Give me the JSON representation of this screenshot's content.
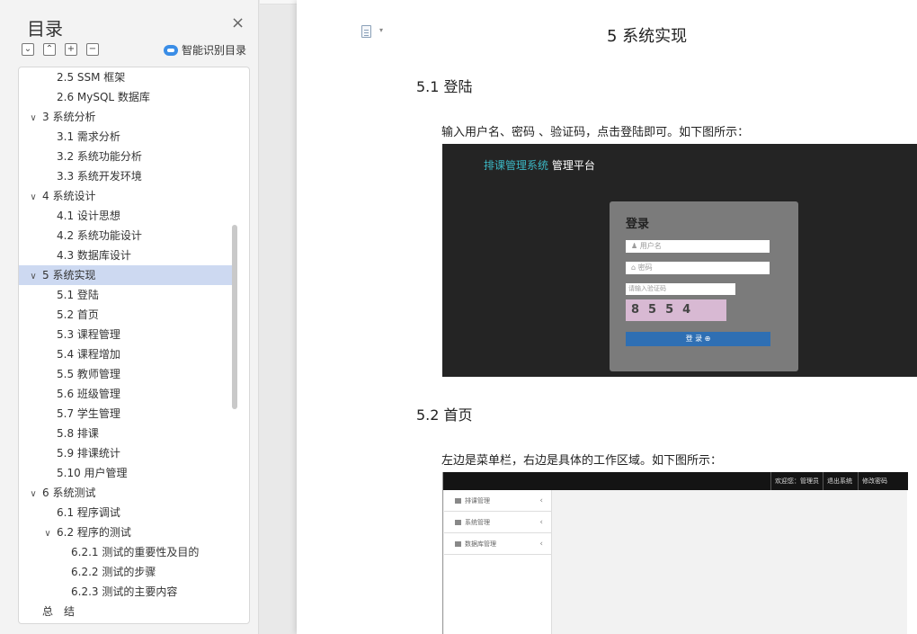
{
  "sidebar": {
    "title": "目录",
    "close_glyph": "×",
    "tools": [
      "⌄",
      "⌃",
      "+",
      "−"
    ],
    "smart_label": "智能识别目录",
    "items": [
      {
        "label": "2.5 SSM 框架",
        "level": 2,
        "chev": ""
      },
      {
        "label": "2.6 MySQL 数据库",
        "level": 2,
        "chev": ""
      },
      {
        "label": "3 系统分析",
        "level": 1,
        "chev": "∨"
      },
      {
        "label": "3.1 需求分析",
        "level": 2,
        "chev": ""
      },
      {
        "label": "3.2 系统功能分析",
        "level": 2,
        "chev": ""
      },
      {
        "label": "3.3 系统开发环境",
        "level": 2,
        "chev": ""
      },
      {
        "label": "4 系统设计",
        "level": 1,
        "chev": "∨"
      },
      {
        "label": "4.1 设计思想",
        "level": 2,
        "chev": ""
      },
      {
        "label": "4.2 系统功能设计",
        "level": 2,
        "chev": ""
      },
      {
        "label": "4.3 数据库设计",
        "level": 2,
        "chev": ""
      },
      {
        "label": "5 系统实现",
        "level": 1,
        "chev": "∨",
        "active": true
      },
      {
        "label": "5.1 登陆",
        "level": 2,
        "chev": ""
      },
      {
        "label": "5.2 首页",
        "level": 2,
        "chev": ""
      },
      {
        "label": "5.3 课程管理",
        "level": 2,
        "chev": ""
      },
      {
        "label": "5.4 课程增加",
        "level": 2,
        "chev": ""
      },
      {
        "label": "5.5 教师管理",
        "level": 2,
        "chev": ""
      },
      {
        "label": "5.6 班级管理",
        "level": 2,
        "chev": ""
      },
      {
        "label": "5.7 学生管理",
        "level": 2,
        "chev": ""
      },
      {
        "label": "5.8 排课",
        "level": 2,
        "chev": ""
      },
      {
        "label": "5.9 排课统计",
        "level": 2,
        "chev": ""
      },
      {
        "label": "5.10 用户管理",
        "level": 2,
        "chev": ""
      },
      {
        "label": "6 系统测试",
        "level": 1,
        "chev": "∨"
      },
      {
        "label": "6.1 程序调试",
        "level": 2,
        "chev": ""
      },
      {
        "label": "6.2 程序的测试",
        "level": 2,
        "chev": "∨"
      },
      {
        "label": "6.2.1 测试的重要性及目的",
        "level": 3,
        "chev": ""
      },
      {
        "label": "6.2.2 测试的步骤",
        "level": 3,
        "chev": ""
      },
      {
        "label": "6.2.3 测试的主要内容",
        "level": 3,
        "chev": ""
      },
      {
        "label": "总　结",
        "level": 1,
        "chev": ""
      }
    ]
  },
  "document": {
    "chapter_title": "5 系统实现",
    "sec1_title": "5.1 登陆",
    "sec1_text": "输入用户名、密码 、验证码，点击登陆即可。如下图所示：",
    "sec2_title": "5.2 首页",
    "sec2_text": "左边是菜单栏，右边是具体的工作区域。如下图所示："
  },
  "login_shot": {
    "brand_colored": "排课管理系统",
    "brand_white": "管理平台",
    "card_title": "登录",
    "username_placeholder": "用户名",
    "password_placeholder": "密码",
    "captcha_placeholder": "请输入验证码",
    "captcha_text": "8554",
    "login_button": "登 录 ⊕"
  },
  "home_shot": {
    "top_buttons": [
      "欢迎您：管理员",
      "退出系统",
      "修改密码"
    ],
    "menu": [
      "排课管理",
      "系统管理",
      "数据库管理"
    ],
    "menu_arrow": "‹"
  }
}
